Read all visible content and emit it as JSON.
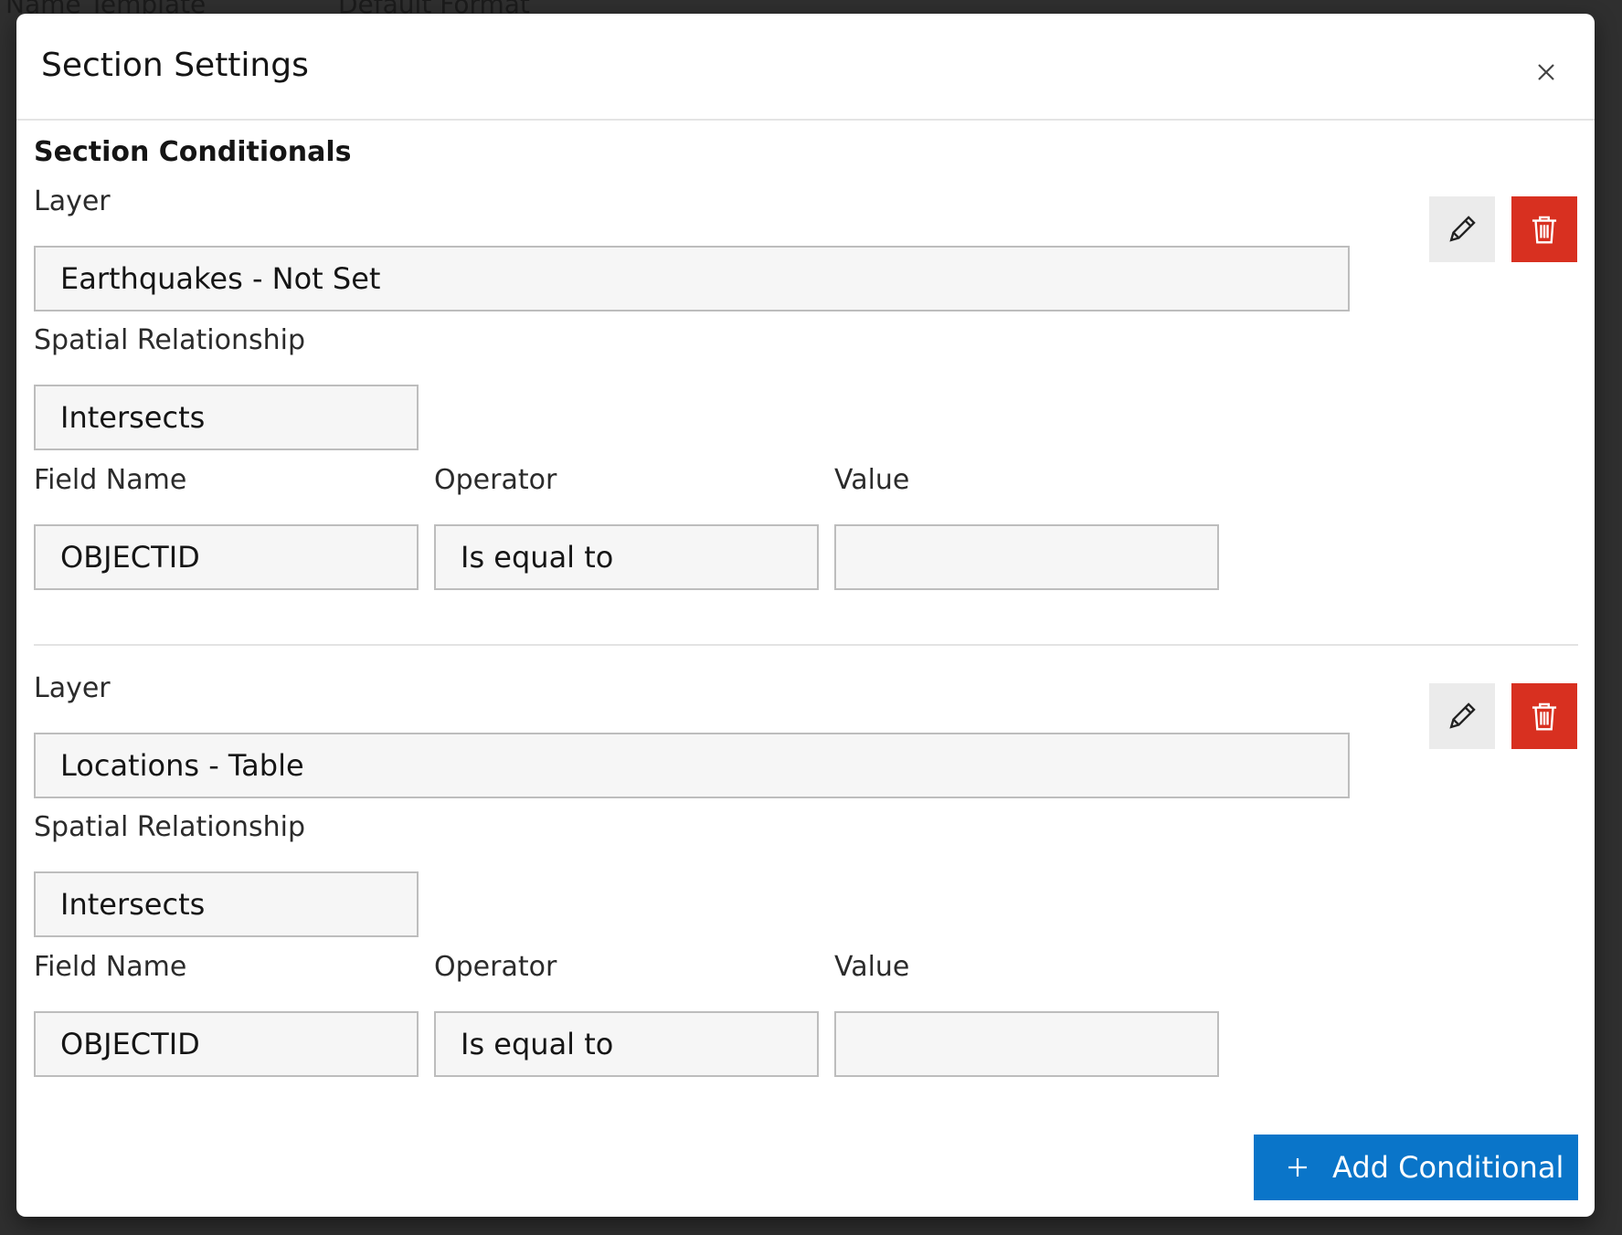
{
  "background": {
    "texts": [
      "Name Template",
      "Default Format"
    ]
  },
  "modal": {
    "title": "Section Settings",
    "close_icon": "close-icon",
    "section_heading": "Section Conditionals",
    "conditionals": [
      {
        "layer_label": "Layer",
        "layer_value": "Earthquakes - Not Set",
        "spatial_label": "Spatial Relationship",
        "spatial_value": "Intersects",
        "field_label": "Field Name",
        "field_value": "OBJECTID",
        "operator_label": "Operator",
        "operator_value": "Is equal to",
        "value_label": "Value",
        "value_value": "",
        "edit_icon": "pencil-icon",
        "delete_icon": "trash-icon"
      },
      {
        "layer_label": "Layer",
        "layer_value": "Locations - Table",
        "spatial_label": "Spatial Relationship",
        "spatial_value": "Intersects",
        "field_label": "Field Name",
        "field_value": "OBJECTID",
        "operator_label": "Operator",
        "operator_value": "Is equal to",
        "value_label": "Value",
        "value_value": "",
        "edit_icon": "pencil-icon",
        "delete_icon": "trash-icon"
      }
    ],
    "add_button": {
      "label": "Add Conditional",
      "icon": "plus-icon"
    }
  },
  "colors": {
    "primary_blue": "#0a75c9",
    "danger_red": "#d83020",
    "field_bg": "#f6f6f6",
    "field_border": "#bdbdbd"
  }
}
